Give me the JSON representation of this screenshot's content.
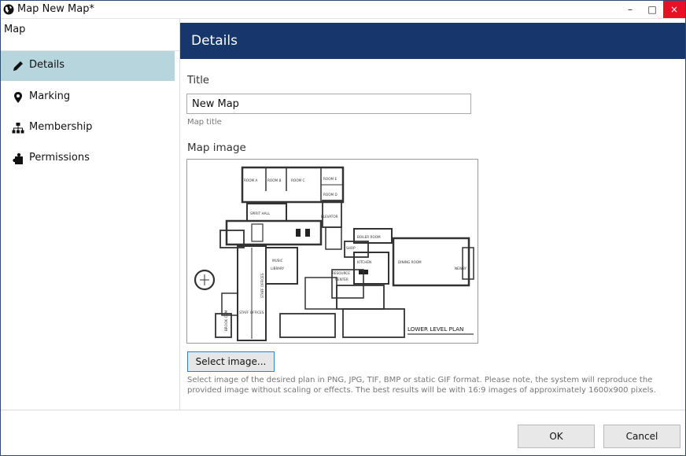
{
  "window": {
    "title": "Map New Map*",
    "minimize_glyph": "–",
    "maximize_glyph": "□",
    "close_glyph": "×"
  },
  "sidebar": {
    "root_label": "Map",
    "items": [
      {
        "label": "Details",
        "icon": "pencil-icon",
        "active": true
      },
      {
        "label": "Marking",
        "icon": "map-marker-icon",
        "active": false
      },
      {
        "label": "Membership",
        "icon": "sitemap-icon",
        "active": false
      },
      {
        "label": "Permissions",
        "icon": "puzzle-icon",
        "active": false
      }
    ]
  },
  "header": {
    "title": "Details"
  },
  "form": {
    "title_label": "Title",
    "title_value": "New Map",
    "title_hint": "Map title",
    "map_image_label": "Map image",
    "select_button": "Select image...",
    "select_hint": "Select image of the desired plan in PNG, JPG, TIF, BMP or static GIF format. Please note, the system will reproduce the provided image without scaling or effects. The best results will be with 16:9 images of approximately 1600x900 pixels."
  },
  "floorplan": {
    "labels": [
      "ROOM A",
      "ROOM B",
      "ROOM C",
      "ROOM E",
      "ROOM D",
      "SPIRIT HALL",
      "ELEVATOR",
      "BOILER ROOM",
      "SHOP",
      "KITCHEN",
      "DINING ROOM",
      "NEWBY",
      "MUSIC",
      "LIBRARY",
      "RESOURCE",
      "CENTER",
      "STAFF OFFICES",
      "STAFF OFFICES",
      "BROOK COM"
    ],
    "caption": "LOWER LEVEL PLAN"
  },
  "footer": {
    "ok": "OK",
    "cancel": "Cancel"
  },
  "colors": {
    "header_bg": "#17366c",
    "active_item_bg": "#b6d5dd",
    "close_bg": "#e81123"
  }
}
